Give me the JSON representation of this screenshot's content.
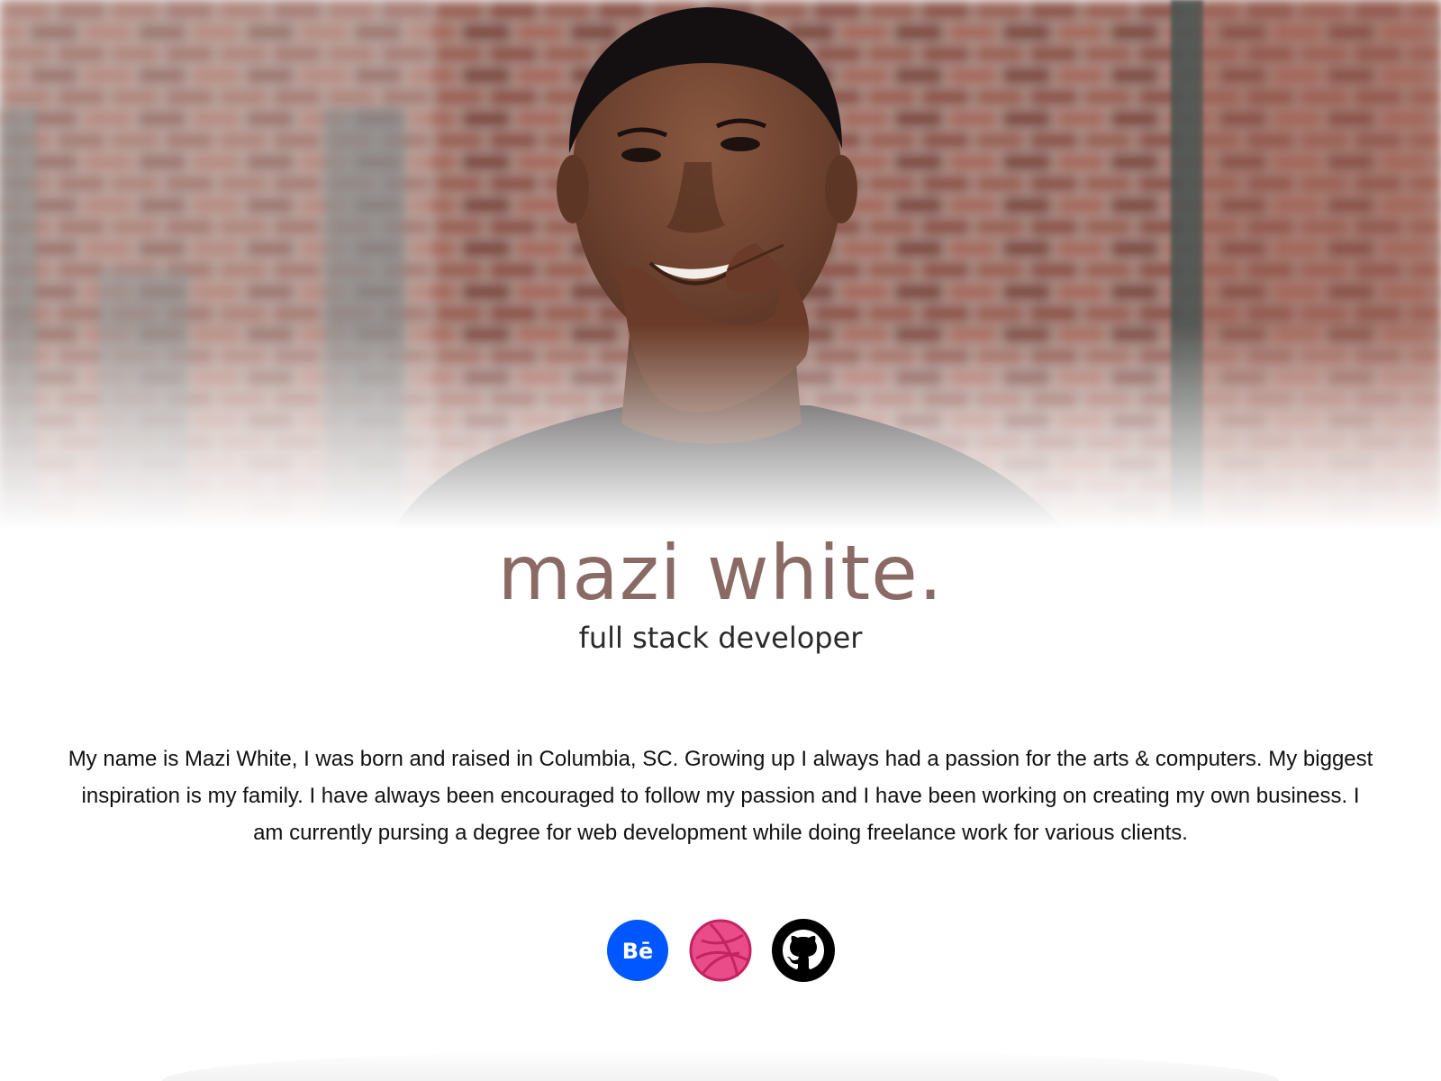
{
  "hero": {
    "photo_alt": "portrait-photo",
    "colors": {
      "brick": "#9a5e52",
      "brick_dark": "#6e3f37",
      "mortar": "#b9aba3",
      "skin": "#7a4a34",
      "shirt": "#2e2a2c"
    }
  },
  "profile": {
    "name": "mazi white.",
    "title": "full stack developer",
    "name_color": "#8a6a64"
  },
  "about": {
    "bio": "My name is Mazi White, I was born and raised in Columbia, SC. Growing up I always had a passion for the arts & computers. My biggest inspiration is my family. I have always been encouraged to follow my passion and I have been working on creating my own business. I am currently pursing a degree for web development while doing freelance work for various clients."
  },
  "socials": [
    {
      "name": "behance",
      "icon": "behance-icon",
      "glyph": "Bē",
      "color": "#0057ff"
    },
    {
      "name": "dribbble",
      "icon": "dribbble-icon",
      "color": "#ea4c89"
    },
    {
      "name": "github",
      "icon": "github-icon",
      "color": "#000000"
    }
  ]
}
